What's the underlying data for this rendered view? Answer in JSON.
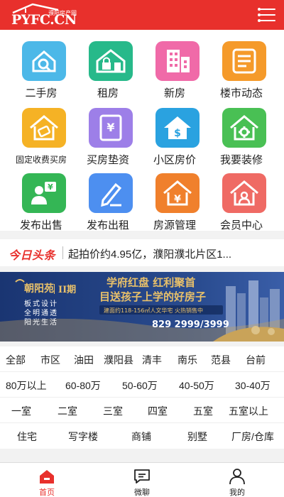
{
  "header": {
    "brand": "PYFC.CN",
    "brand_cn": "濮阳房产网"
  },
  "grid": [
    {
      "label": "二手房",
      "icon": "magnifier-house-icon",
      "color": "#4cb8e8"
    },
    {
      "label": "租房",
      "icon": "house-lock-icon",
      "color": "#27b98a"
    },
    {
      "label": "新房",
      "icon": "building-icon",
      "color": "#f06aa8"
    },
    {
      "label": "楼市动态",
      "icon": "document-news-icon",
      "color": "#f59a2a"
    },
    {
      "label": "固定收费买房",
      "icon": "price-tag-house-icon",
      "color": "#f5b225"
    },
    {
      "label": "买房垫资",
      "icon": "yuan-card-icon",
      "color": "#9d7fe8"
    },
    {
      "label": "小区房价",
      "icon": "dollar-house-icon",
      "color": "#2aa2e0"
    },
    {
      "label": "我要装修",
      "icon": "gear-house-icon",
      "color": "#49c054"
    },
    {
      "label": "发布出售",
      "icon": "user-sale-icon",
      "color": "#34b655"
    },
    {
      "label": "发布出租",
      "icon": "pen-edit-icon",
      "color": "#4d8ff0"
    },
    {
      "label": "房源管理",
      "icon": "yuan-house-icon",
      "color": "#f0802c"
    },
    {
      "label": "会员中心",
      "icon": "member-house-icon",
      "color": "#ef6a64"
    }
  ],
  "headline": {
    "logo": "今日头条",
    "text": "起拍价约4.95亿，濮阳濮北片区1..."
  },
  "banner": {
    "project": "朝阳苑",
    "phase": "II期",
    "title": "学府红盘  红利聚首",
    "subtitle": "目送孩子上学的好房子",
    "tagline": "建面约118-156㎡人文华宅  火热销售中",
    "features": [
      "板式设计",
      "全明通透",
      "阳光生活"
    ],
    "phone": "829 2999/3999"
  },
  "filters": {
    "areas": [
      "全部",
      "市区",
      "油田",
      "濮阳县",
      "清丰",
      "南乐",
      "范县",
      "台前"
    ],
    "prices": [
      "80万以上",
      "60-80万",
      "50-60万",
      "40-50万",
      "30-40万"
    ],
    "rooms": [
      "一室",
      "二室",
      "三室",
      "四室",
      "五室",
      "五室以上"
    ],
    "types": [
      "住宅",
      "写字楼",
      "商铺",
      "别墅",
      "厂房/仓库"
    ]
  },
  "bottom_nav": [
    {
      "label": "首页",
      "icon": "home-icon",
      "active": true
    },
    {
      "label": "微聊",
      "icon": "chat-icon",
      "active": false
    },
    {
      "label": "我的",
      "icon": "user-icon",
      "active": false
    }
  ],
  "colors": {
    "brand_red": "#e8302c",
    "banner_blue": "#1d3c7a",
    "banner_gold": "#e8c06a"
  }
}
